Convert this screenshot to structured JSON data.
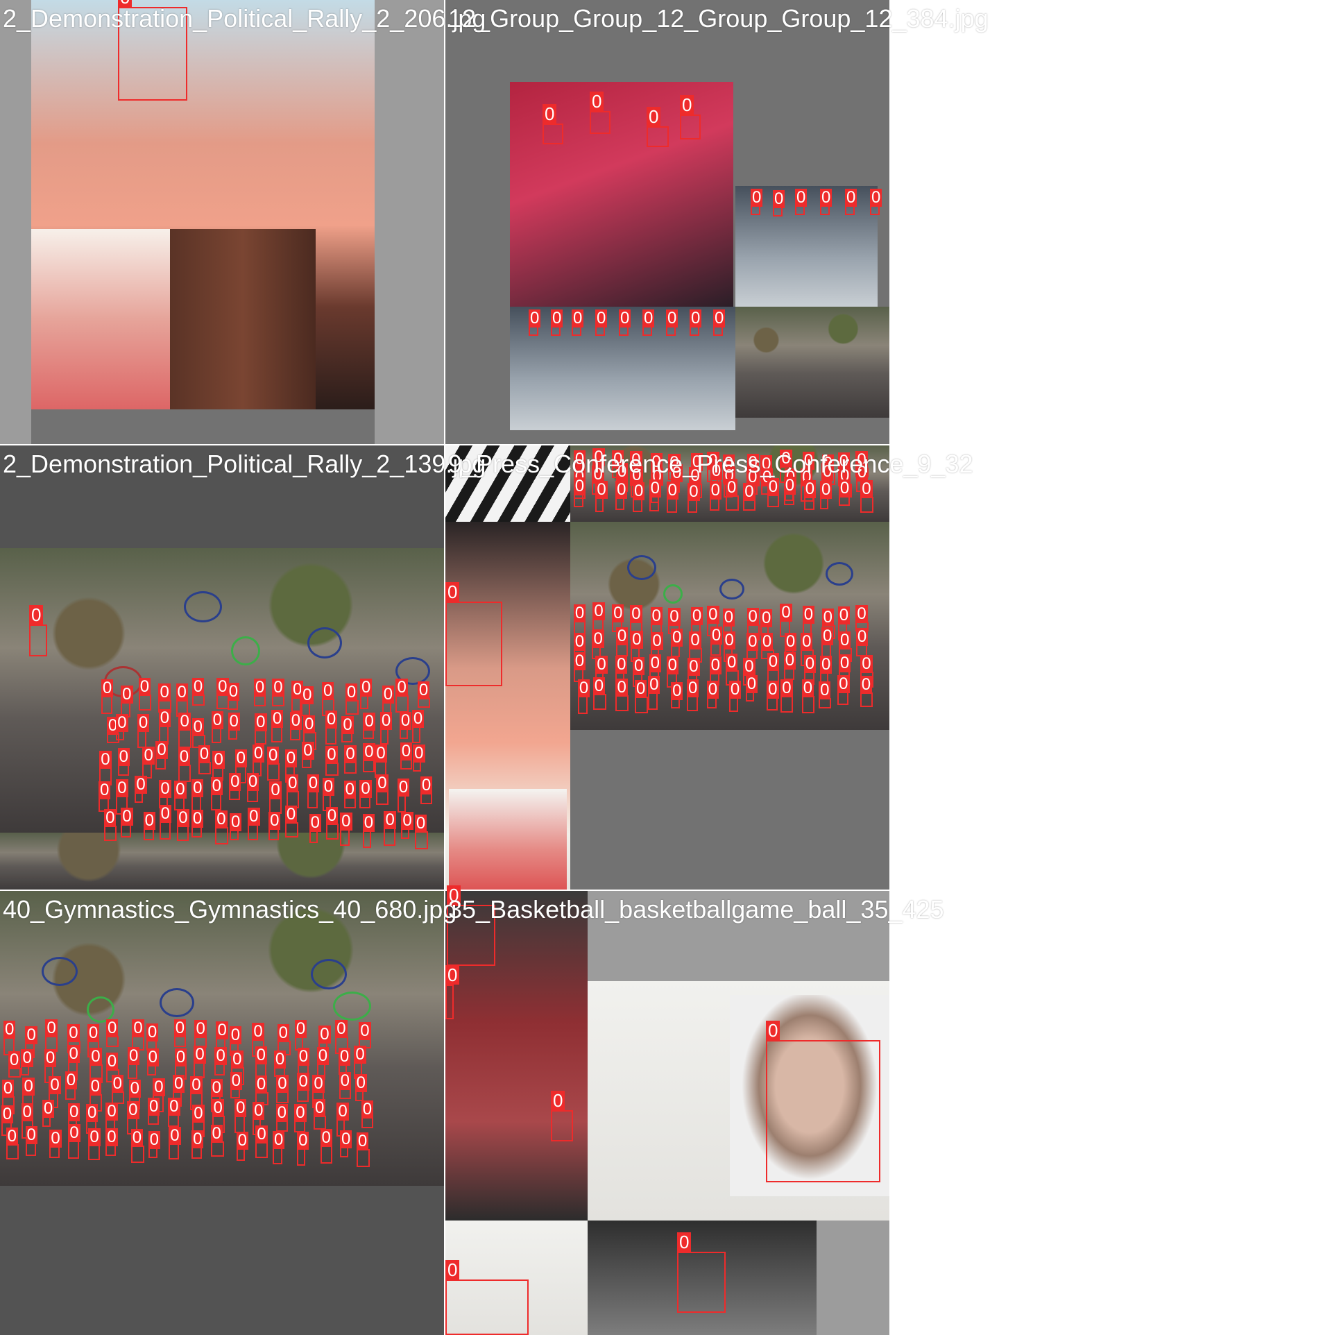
{
  "tiles": [
    {
      "title": "2_Demonstration_Political_Rally_2_206.jpg"
    },
    {
      "title": "12_Group_Group_12_Group_Group_12_384.jpg"
    },
    {
      "title": "2_Demonstration_Political_Rally_2_139.jpg"
    },
    {
      "title": "9_Press_Conference_Press_Conference_9_32"
    },
    {
      "title": "40_Gymnastics_Gymnastics_40_680.jpg"
    },
    {
      "title": "35_Basketball_basketballgame_ball_35_425"
    }
  ],
  "detection_label": "0",
  "colors": {
    "box": "#ee2b2b",
    "tile_bg": "#727272",
    "pad_gray": "#9c9c9c",
    "pad_dark": "#535353"
  }
}
